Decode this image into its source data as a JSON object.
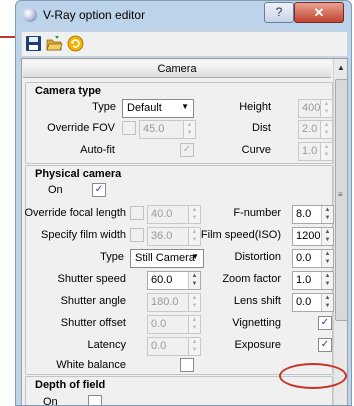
{
  "window": {
    "title": "V-Ray option editor",
    "help_label": "?",
    "close_label": "✕"
  },
  "toolbar": {
    "save_icon": "floppy-disk-icon",
    "open_icon": "open-folder-icon",
    "refresh_icon": "refresh-icon"
  },
  "section": {
    "title": "Camera"
  },
  "camera_type": {
    "group_title": "Camera type",
    "type_label": "Type",
    "type_value": "Default",
    "height_label": "Height",
    "height_value": "400.0",
    "override_fov_label": "Override FOV",
    "override_fov_checked": false,
    "fov_value": "45.0",
    "dist_label": "Dist",
    "dist_value": "2.0",
    "autofit_label": "Auto-fit",
    "autofit_checked": true,
    "curve_label": "Curve",
    "curve_value": "1.0"
  },
  "physical_camera": {
    "group_title": "Physical camera",
    "on_label": "On",
    "on_checked": true,
    "override_focal_label": "Override focal length",
    "override_focal_checked": false,
    "focal_value": "40.0",
    "fnumber_label": "F-number",
    "fnumber_value": "8.0",
    "film_width_label": "Specify film width",
    "film_width_checked": false,
    "film_width_value": "36.0",
    "film_speed_label": "Film speed(ISO)",
    "film_speed_value": "1200.0",
    "type_label": "Type",
    "type_value": "Still Camera",
    "distortion_label": "Distortion",
    "distortion_value": "0.0",
    "shutter_speed_label": "Shutter speed",
    "shutter_speed_value": "60.0",
    "zoom_label": "Zoom factor",
    "zoom_value": "1.0",
    "shutter_angle_label": "Shutter angle",
    "shutter_angle_value": "180.0",
    "lens_shift_label": "Lens shift",
    "lens_shift_value": "0.0",
    "shutter_offset_label": "Shutter offset",
    "shutter_offset_value": "0.0",
    "vignetting_label": "Vignetting",
    "vignetting_checked": true,
    "latency_label": "Latency",
    "latency_value": "0.0",
    "exposure_label": "Exposure",
    "exposure_checked": true,
    "white_balance_label": "White balance"
  },
  "depth_of_field": {
    "group_title": "Depth of field",
    "on_label": "On",
    "on_checked": false
  },
  "annotation": {
    "color": "#c8332b"
  }
}
